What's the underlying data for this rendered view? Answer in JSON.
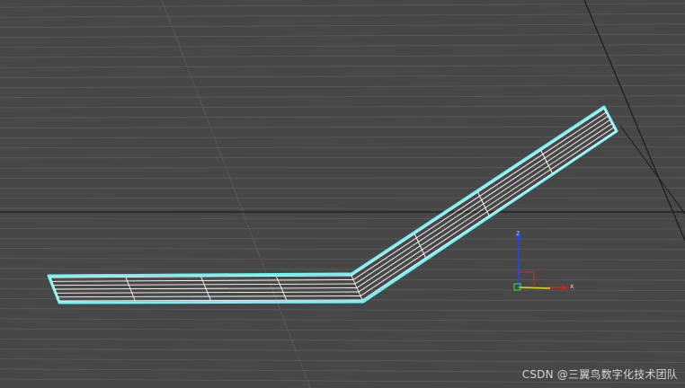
{
  "viewport": {
    "colors": {
      "background": "#474747",
      "grid_line": "#5c5c5c",
      "grid_major": "#1c1c1c",
      "selection": "#6ff5f8",
      "wireframe": "#ffffff",
      "axis_x": "#d82020",
      "axis_y": "#d8d820",
      "axis_z": "#2244ff",
      "pivot": "#30d030"
    }
  },
  "gizmo": {
    "x_label": "x",
    "z_label": "z",
    "icon": "transform-axis-gizmo-icon"
  },
  "watermark": {
    "text": "CSDN @三翼鸟数字化技术团队"
  }
}
